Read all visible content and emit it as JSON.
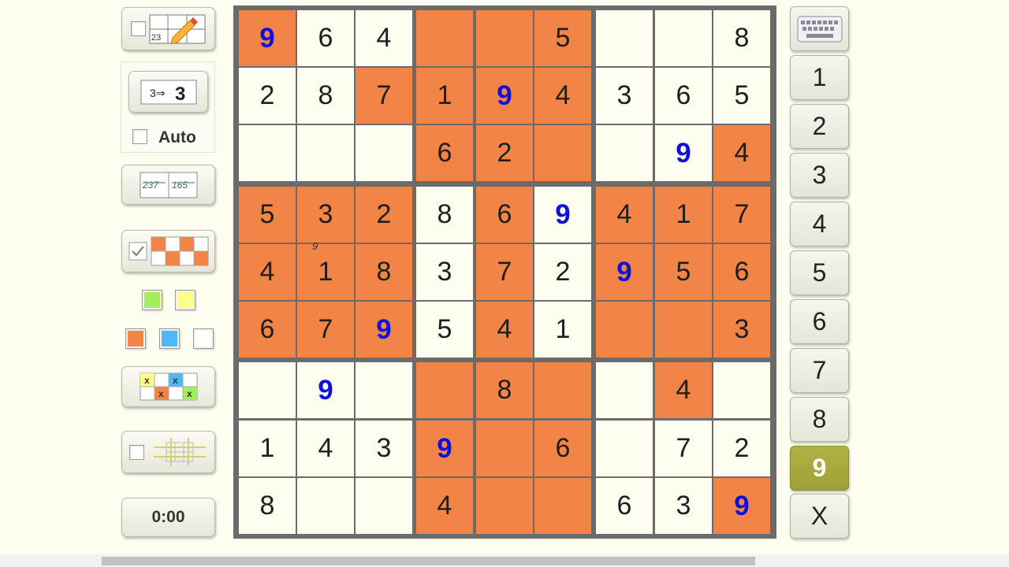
{
  "board": {
    "rows": [
      [
        "9",
        "6",
        "4",
        "",
        "",
        "5",
        "",
        "",
        "8"
      ],
      [
        "2",
        "8",
        "7",
        "1",
        "9",
        "4",
        "3",
        "6",
        "5"
      ],
      [
        "",
        "",
        "",
        "6",
        "2",
        "",
        "",
        "9",
        "4"
      ],
      [
        "5",
        "3",
        "2",
        "8",
        "6",
        "9",
        "4",
        "1",
        "7"
      ],
      [
        "4",
        "1",
        "8",
        "3",
        "7",
        "2",
        "9",
        "5",
        "6"
      ],
      [
        "6",
        "7",
        "9",
        "5",
        "4",
        "1",
        "",
        "",
        "3"
      ],
      [
        "",
        "9",
        "",
        "",
        "8",
        "",
        "",
        "4",
        ""
      ],
      [
        "1",
        "4",
        "3",
        "9",
        "",
        "6",
        "",
        "7",
        "2"
      ],
      [
        "8",
        "",
        "",
        "4",
        "",
        "",
        "6",
        "3",
        "9"
      ]
    ],
    "highlight": [
      [
        1,
        0,
        0,
        1,
        1,
        1,
        0,
        0,
        0
      ],
      [
        0,
        0,
        1,
        1,
        1,
        1,
        0,
        0,
        0
      ],
      [
        0,
        0,
        0,
        1,
        1,
        1,
        0,
        0,
        1
      ],
      [
        1,
        1,
        1,
        0,
        1,
        0,
        1,
        1,
        1
      ],
      [
        1,
        1,
        1,
        0,
        1,
        0,
        1,
        1,
        1
      ],
      [
        1,
        1,
        1,
        0,
        1,
        0,
        1,
        1,
        1
      ],
      [
        0,
        0,
        0,
        1,
        1,
        1,
        0,
        1,
        0
      ],
      [
        0,
        0,
        0,
        1,
        1,
        1,
        0,
        0,
        0
      ],
      [
        0,
        0,
        0,
        1,
        1,
        1,
        0,
        0,
        1
      ]
    ],
    "selected_digit": "9",
    "colors": {
      "highlight": "#f28446",
      "empty": "#fdfdf0",
      "given_digit": "#1010d8",
      "grid": "#6b6b6b"
    }
  },
  "tools": {
    "notes_icon_text": "23",
    "auto_convert_icon": "3⇒3",
    "auto_label": "Auto",
    "cleanup_icon_left": "237",
    "cleanup_icon_right": "165",
    "palette": [
      "#a2ee5a",
      "#fdfd8a",
      "#f28446",
      "#4cb8f6",
      "#ffffff"
    ],
    "timer": "0:00",
    "cursor_note": "9"
  },
  "keypad": {
    "keys": [
      "1",
      "2",
      "3",
      "4",
      "5",
      "6",
      "7",
      "8",
      "9",
      "X"
    ],
    "active": "9"
  }
}
